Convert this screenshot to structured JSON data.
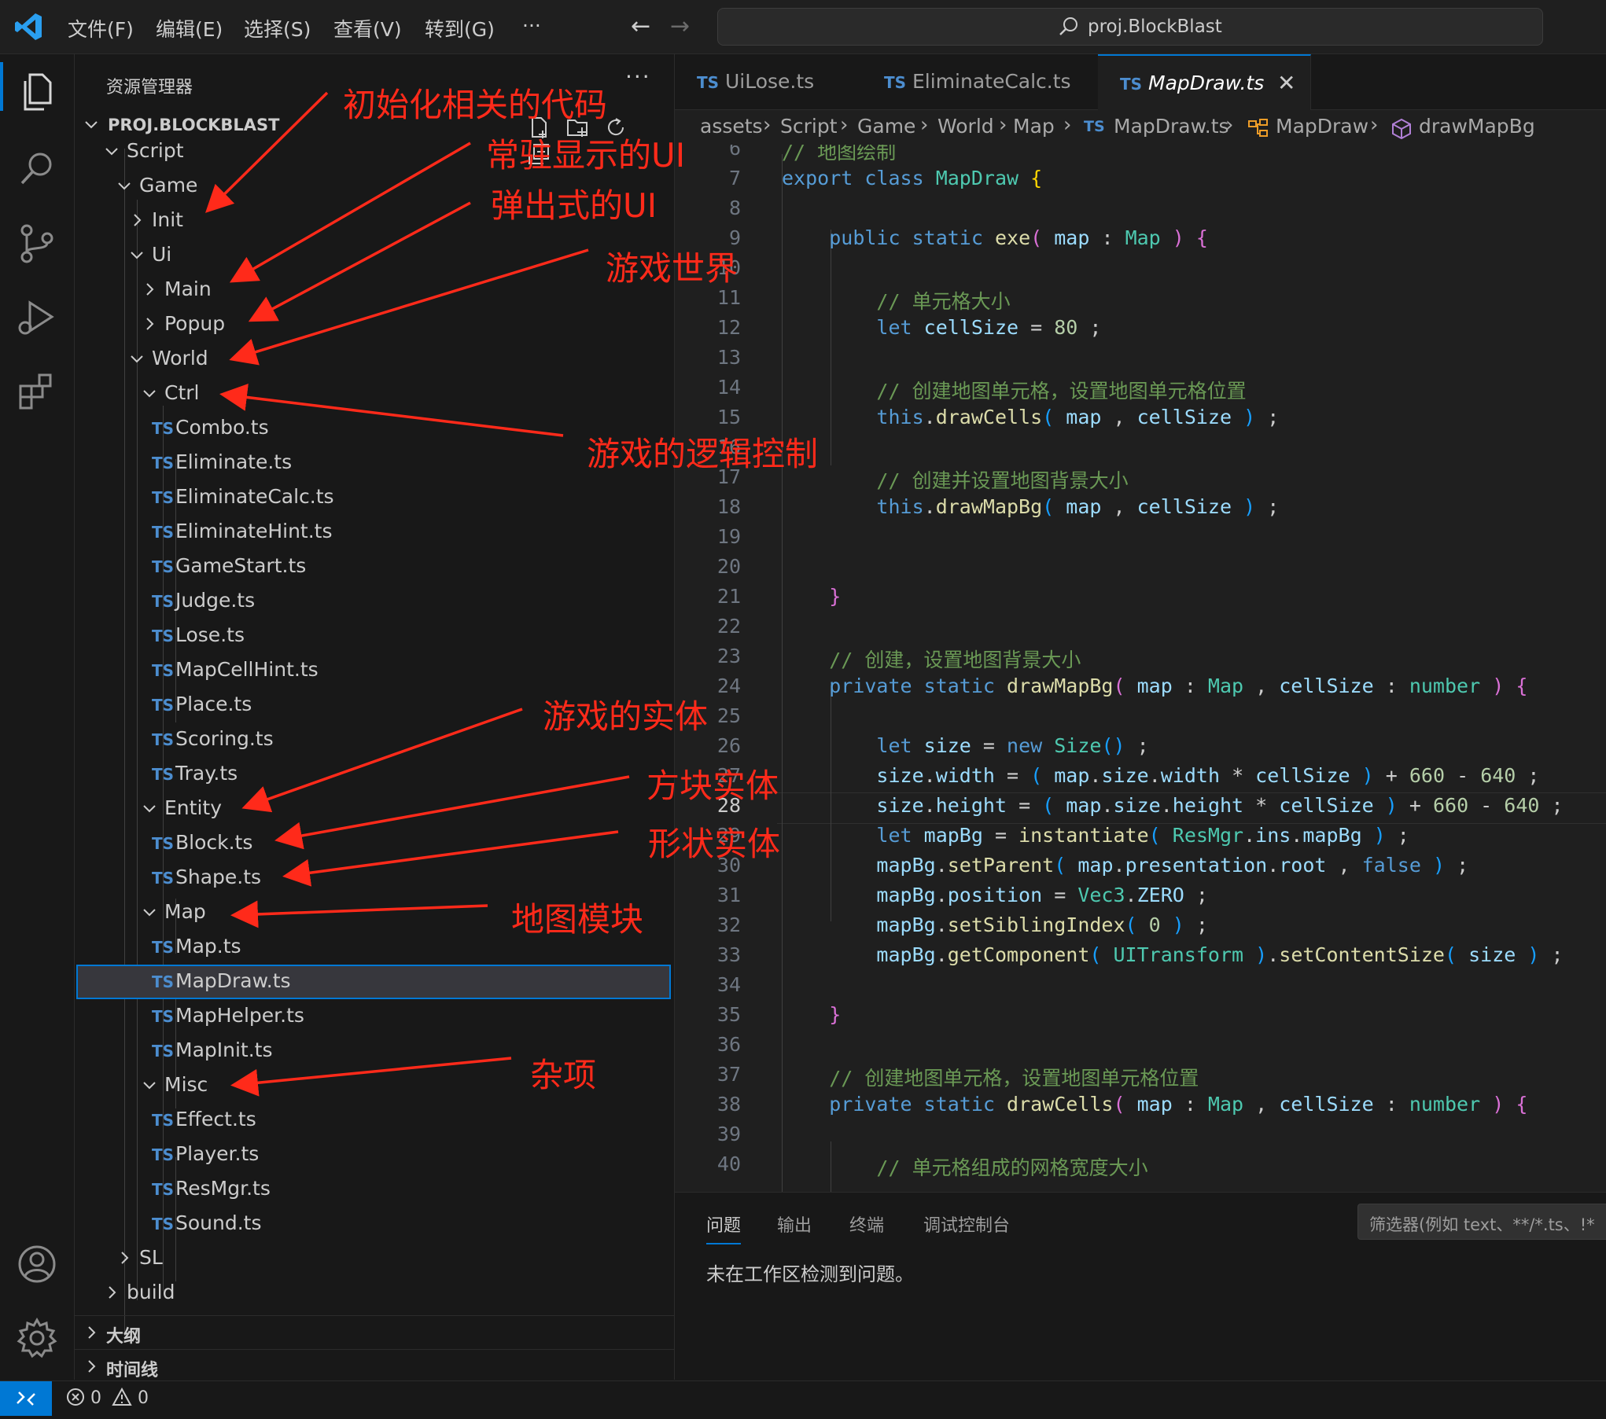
{
  "titlebar": {
    "menus": [
      "文件(F)",
      "编辑(E)",
      "选择(S)",
      "查看(V)",
      "转到(G)",
      "···"
    ],
    "back": "←",
    "forward": "→",
    "search_text": "proj.BlockBlast"
  },
  "explorer": {
    "title": "资源管理器",
    "more": "···",
    "root": "PROJ.BLOCKBLAST",
    "tree": [
      {
        "label": "Script",
        "type": "folder",
        "open": true
      },
      {
        "label": "Game",
        "type": "folder",
        "open": true
      },
      {
        "label": "Init",
        "type": "folder",
        "open": false
      },
      {
        "label": "Ui",
        "type": "folder",
        "open": true
      },
      {
        "label": "Main",
        "type": "folder",
        "open": false
      },
      {
        "label": "Popup",
        "type": "folder",
        "open": false
      },
      {
        "label": "World",
        "type": "folder",
        "open": true
      },
      {
        "label": "Ctrl",
        "type": "folder",
        "open": true
      },
      {
        "label": "Combo.ts",
        "type": "file"
      },
      {
        "label": "Eliminate.ts",
        "type": "file"
      },
      {
        "label": "EliminateCalc.ts",
        "type": "file"
      },
      {
        "label": "EliminateHint.ts",
        "type": "file"
      },
      {
        "label": "GameStart.ts",
        "type": "file"
      },
      {
        "label": "Judge.ts",
        "type": "file"
      },
      {
        "label": "Lose.ts",
        "type": "file"
      },
      {
        "label": "MapCellHint.ts",
        "type": "file"
      },
      {
        "label": "Place.ts",
        "type": "file"
      },
      {
        "label": "Scoring.ts",
        "type": "file"
      },
      {
        "label": "Tray.ts",
        "type": "file"
      },
      {
        "label": "Entity",
        "type": "folder",
        "open": true
      },
      {
        "label": "Block.ts",
        "type": "file"
      },
      {
        "label": "Shape.ts",
        "type": "file"
      },
      {
        "label": "Map",
        "type": "folder",
        "open": true
      },
      {
        "label": "Map.ts",
        "type": "file"
      },
      {
        "label": "MapDraw.ts",
        "type": "file",
        "selected": true
      },
      {
        "label": "MapHelper.ts",
        "type": "file"
      },
      {
        "label": "MapInit.ts",
        "type": "file"
      },
      {
        "label": "Misc",
        "type": "folder",
        "open": true
      },
      {
        "label": "Effect.ts",
        "type": "file"
      },
      {
        "label": "Player.ts",
        "type": "file"
      },
      {
        "label": "ResMgr.ts",
        "type": "file"
      },
      {
        "label": "Sound.ts",
        "type": "file"
      },
      {
        "label": "SL",
        "type": "folder",
        "open": false
      },
      {
        "label": "build",
        "type": "folder",
        "open": false
      }
    ],
    "ts_badge": "TS",
    "outline_label": "大纲",
    "timeline_label": "时间线"
  },
  "tabs": [
    {
      "label": "UiLose.ts",
      "active": false
    },
    {
      "label": "EliminateCalc.ts",
      "active": false
    },
    {
      "label": "MapDraw.ts",
      "active": true
    }
  ],
  "tab_close": "✕",
  "breadcrumb": [
    "assets",
    "Script",
    "Game",
    "World",
    "Map",
    "MapDraw.ts",
    "MapDraw",
    "drawMapBg"
  ],
  "editor": {
    "current_line": 28,
    "line_numbers": [
      "6",
      "7",
      "8",
      "9",
      "10",
      "11",
      "12",
      "13",
      "14",
      "15",
      "16",
      "17",
      "18",
      "19",
      "20",
      "21",
      "22",
      "23",
      "24",
      "25",
      "26",
      "27",
      "28",
      "29",
      "30",
      "31",
      "32",
      "33",
      "34",
      "35",
      "36",
      "37",
      "38",
      "39",
      "40"
    ]
  },
  "panel": {
    "tabs": [
      "问题",
      "输出",
      "终端",
      "调试控制台"
    ],
    "filter_placeholder": "筛选器(例如 text、**/*.ts、!*",
    "message": "未在工作区检测到问题。"
  },
  "status": {
    "errors": "0",
    "warnings": "0"
  },
  "annotations": [
    "初始化相关的代码",
    "常驻显示的UI",
    "弹出式的UI",
    "游戏世界",
    "游戏的逻辑控制",
    "游戏的实体",
    "方块实体",
    "形状实体",
    "地图模块",
    "杂项"
  ],
  "colors": {
    "accent": "#0078d4",
    "annotation_red": "#ff2a1a",
    "ts_blue": "#4c8dcf"
  }
}
